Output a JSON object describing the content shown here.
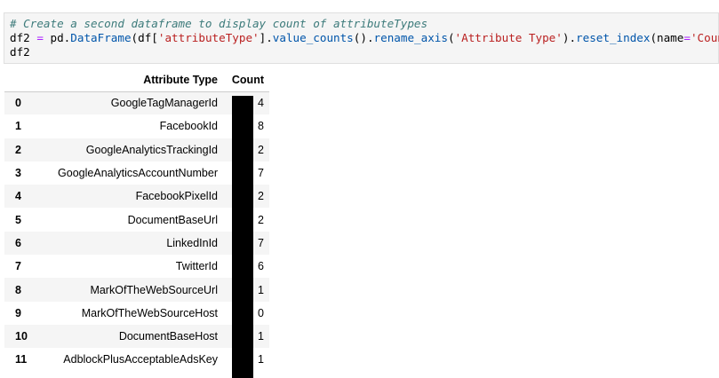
{
  "code": {
    "comment": "# Create a second dataframe to display count of attributeTypes",
    "line2": [
      {
        "t": "df2 ",
        "c": ""
      },
      {
        "t": "=",
        "c": "op"
      },
      {
        "t": " pd.",
        "c": ""
      },
      {
        "t": "DataFrame",
        "c": "fn"
      },
      {
        "t": "(df[",
        "c": ""
      },
      {
        "t": "'attributeType'",
        "c": "st"
      },
      {
        "t": "].",
        "c": ""
      },
      {
        "t": "value_counts",
        "c": "fn"
      },
      {
        "t": "().",
        "c": ""
      },
      {
        "t": "rename_axis",
        "c": "fn"
      },
      {
        "t": "(",
        "c": ""
      },
      {
        "t": "'Attribute Type'",
        "c": "st"
      },
      {
        "t": ").",
        "c": ""
      },
      {
        "t": "reset_index",
        "c": "fn"
      },
      {
        "t": "(name",
        "c": ""
      },
      {
        "t": "=",
        "c": "op"
      },
      {
        "t": "'Count'",
        "c": "st"
      },
      {
        "t": "))",
        "c": ""
      }
    ],
    "line3": "df2"
  },
  "table": {
    "headers": [
      "",
      "Attribute Type",
      "Count"
    ],
    "rows": [
      [
        "0",
        "GoogleTagManagerId",
        "4"
      ],
      [
        "1",
        "FacebookId",
        "8"
      ],
      [
        "2",
        "GoogleAnalyticsTrackingId",
        "2"
      ],
      [
        "3",
        "GoogleAnalyticsAccountNumber",
        "7"
      ],
      [
        "4",
        "FacebookPixelId",
        "2"
      ],
      [
        "5",
        "DocumentBaseUrl",
        "2"
      ],
      [
        "6",
        "LinkedInId",
        "7"
      ],
      [
        "7",
        "TwitterId",
        "6"
      ],
      [
        "8",
        "MarkOfTheWebSourceUrl",
        "1"
      ],
      [
        "9",
        "MarkOfTheWebSourceHost",
        "0"
      ],
      [
        "10",
        "DocumentBaseHost",
        "1"
      ],
      [
        "11",
        "AdblockPlusAcceptableAdsKey",
        "1"
      ]
    ]
  }
}
